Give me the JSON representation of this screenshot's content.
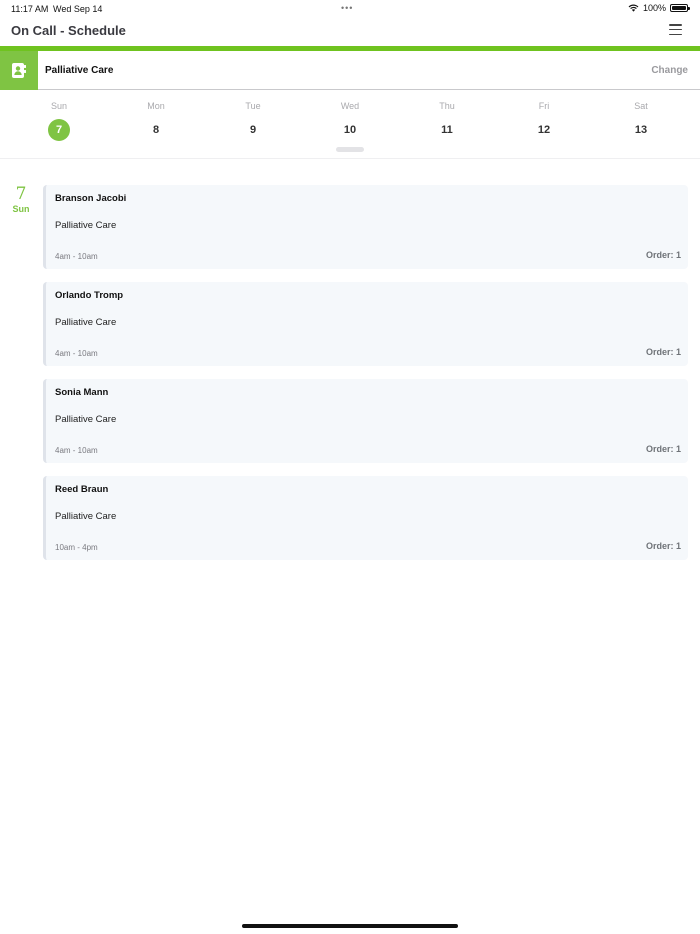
{
  "status_bar": {
    "time": "11:17 AM",
    "date": "Wed Sep 14",
    "dots": "•••",
    "battery_text": "100%",
    "battery_level": 1.0
  },
  "nav": {
    "title": "On Call - Schedule",
    "menu_icon": "hamburger-menu-icon"
  },
  "colors": {
    "accent": "#6fc31f",
    "selected_day": "#7fc443",
    "card_bg": "#f5f8fb"
  },
  "unit_selector": {
    "icon": "contact-book-icon",
    "name": "Palliative Care",
    "change_label": "Change"
  },
  "week": {
    "days": [
      {
        "name": "Sun",
        "num": "7",
        "selected": true
      },
      {
        "name": "Mon",
        "num": "8",
        "selected": false
      },
      {
        "name": "Tue",
        "num": "9",
        "selected": false
      },
      {
        "name": "Wed",
        "num": "10",
        "selected": false
      },
      {
        "name": "Thu",
        "num": "11",
        "selected": false
      },
      {
        "name": "Fri",
        "num": "12",
        "selected": false
      },
      {
        "name": "Sat",
        "num": "13",
        "selected": false
      }
    ]
  },
  "schedule": {
    "date_num": "7",
    "date_name": "Sun",
    "entries": [
      {
        "person": "Branson Jacobi",
        "unit": "Palliative Care",
        "time": "4am - 10am",
        "order": "Order: 1"
      },
      {
        "person": "Orlando Tromp",
        "unit": "Palliative Care",
        "time": "4am - 10am",
        "order": "Order: 1"
      },
      {
        "person": "Sonia Mann",
        "unit": "Palliative Care",
        "time": "4am - 10am",
        "order": "Order: 1"
      },
      {
        "person": "Reed Braun",
        "unit": "Palliative Care",
        "time": "10am - 4pm",
        "order": "Order: 1"
      }
    ]
  }
}
